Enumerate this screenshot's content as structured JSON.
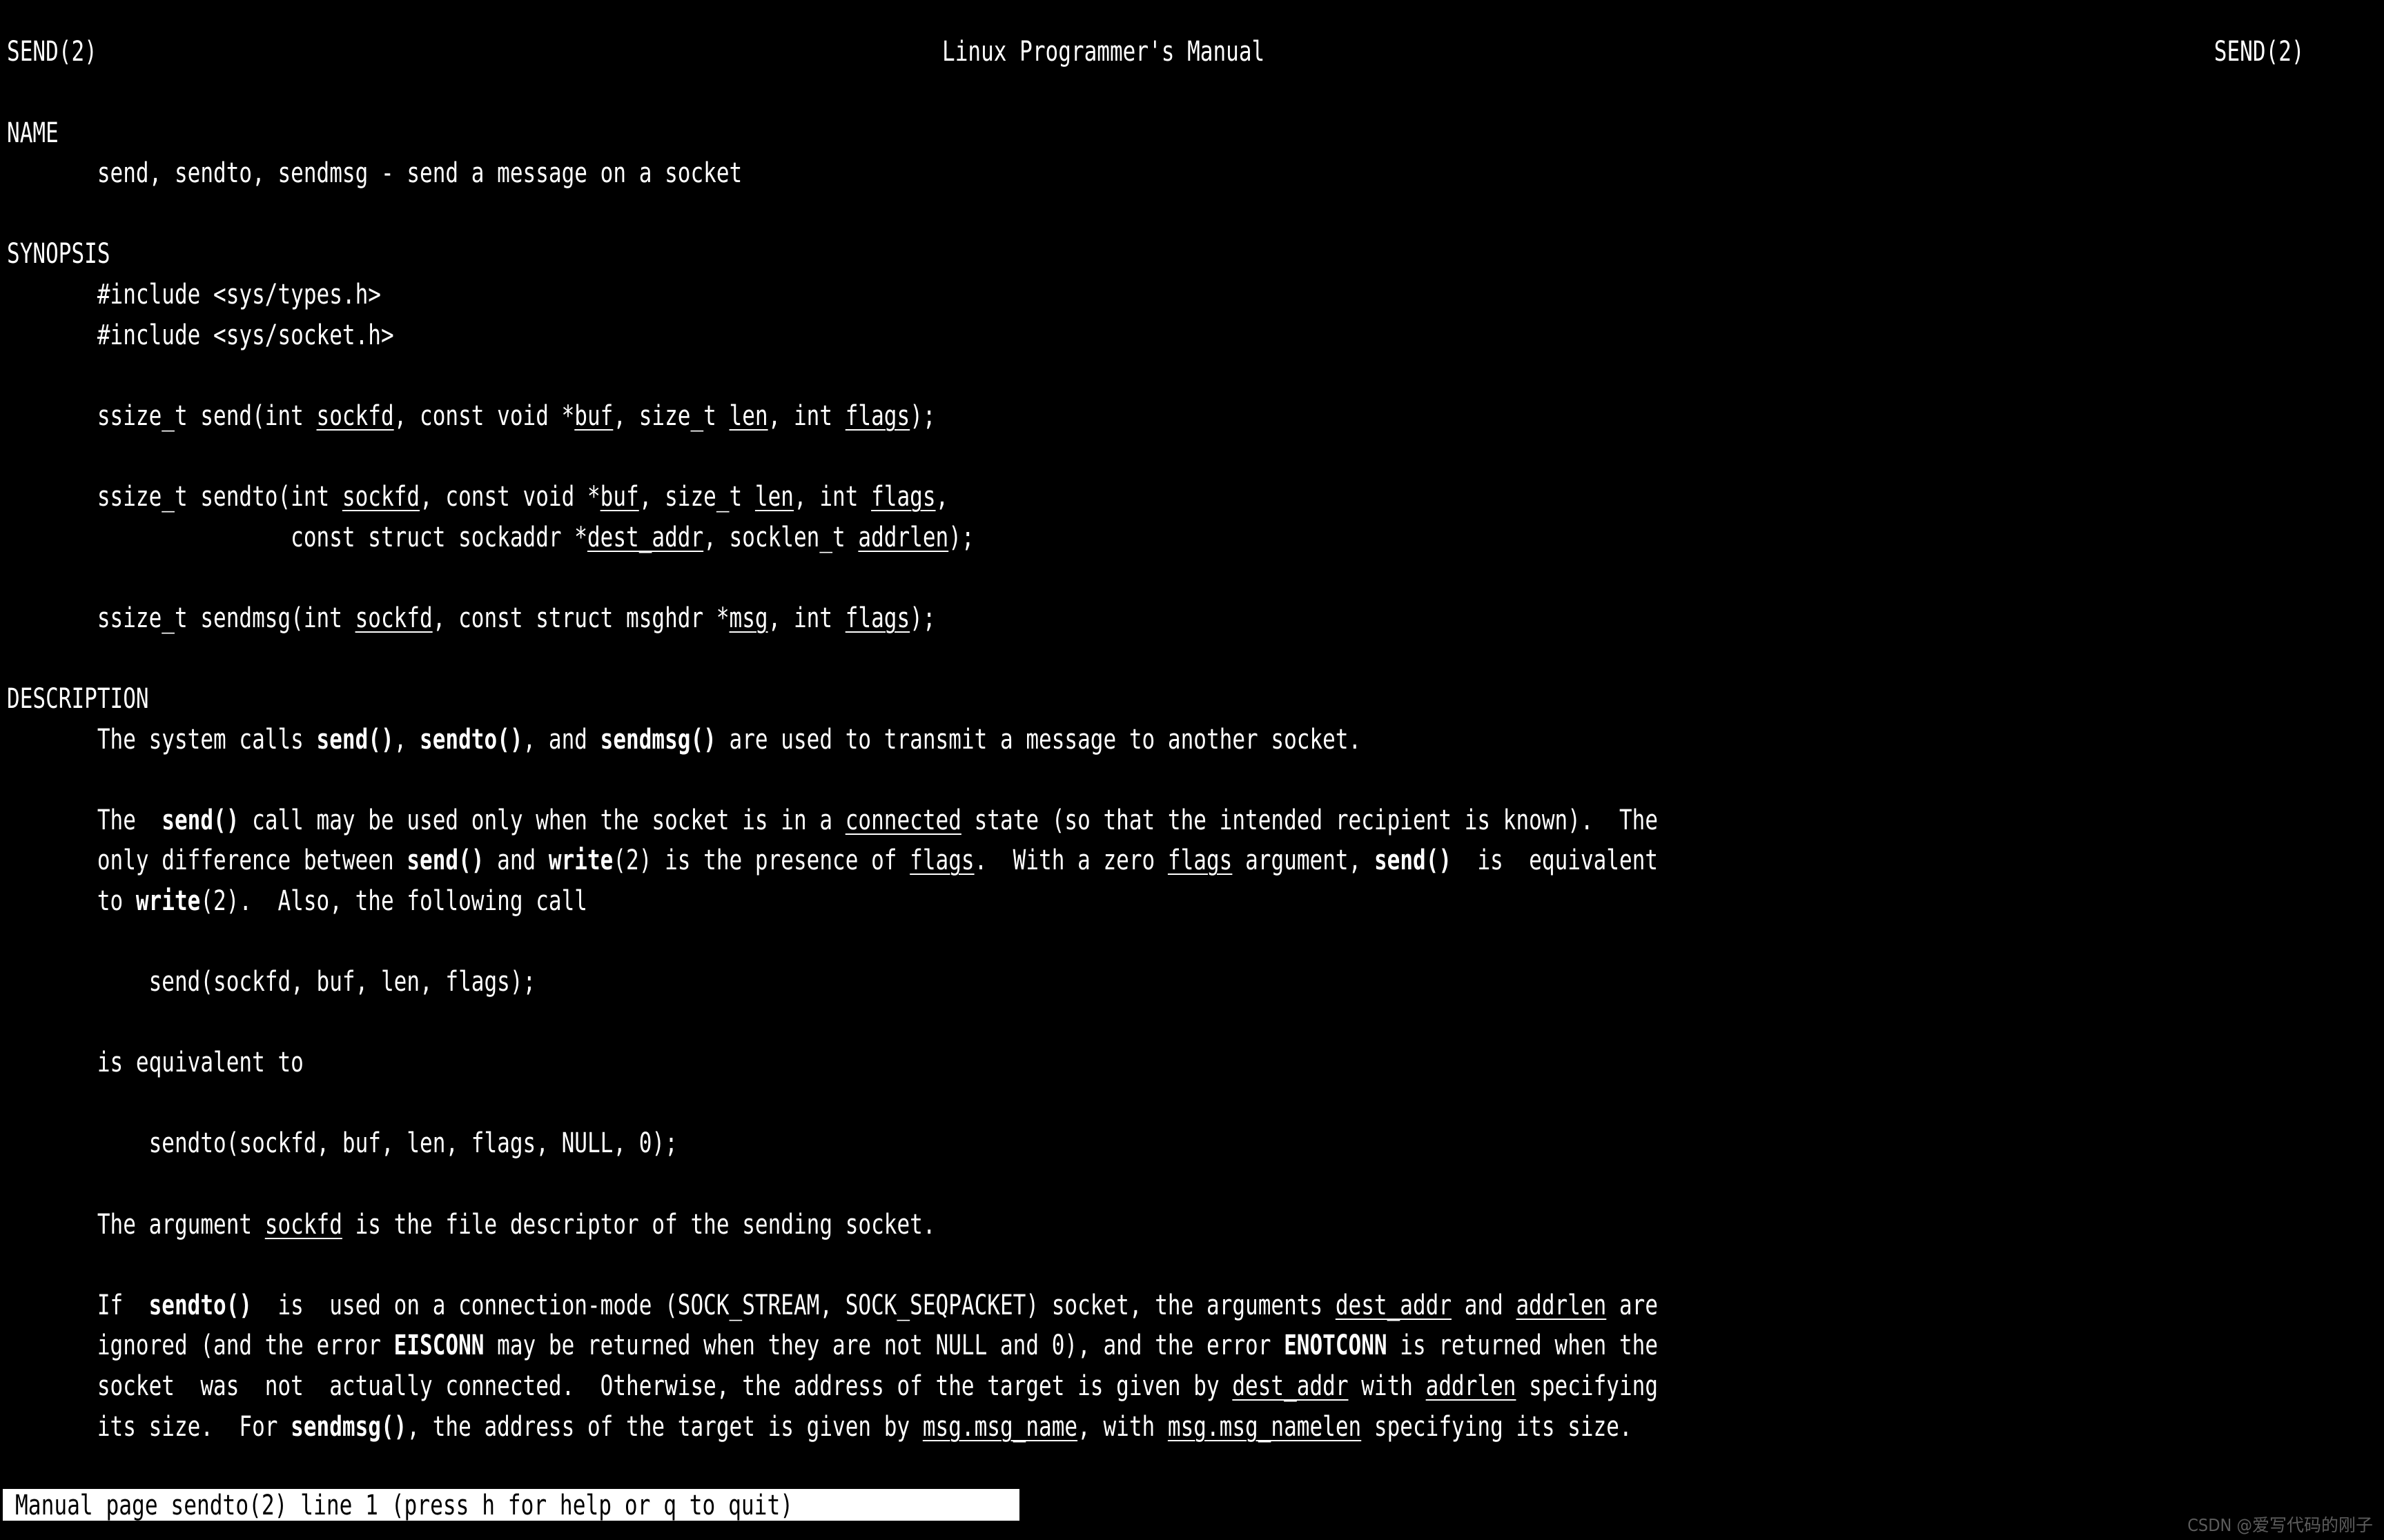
{
  "terminal": {
    "background_color": "#000000",
    "foreground_color": "#ffffff",
    "program": "man"
  },
  "header": {
    "left": "SEND(2)",
    "center": "Linux Programmer's Manual",
    "right": "SEND(2)"
  },
  "sections": {
    "name": {
      "heading": "NAME",
      "body": "send, sendto, sendmsg - send a message on a socket"
    },
    "synopsis": {
      "heading": "SYNOPSIS",
      "include1": "#include <sys/types.h>",
      "include2": "#include <sys/socket.h>",
      "proto_send": {
        "prefix": "ssize_t send(int ",
        "p1": "sockfd",
        "mid1": ", const void *",
        "p2": "buf",
        "mid2": ", size_t ",
        "p3": "len",
        "mid3": ", int ",
        "p4": "flags",
        "suffix": ");"
      },
      "proto_sendto_line1": {
        "prefix": "ssize_t sendto(int ",
        "p1": "sockfd",
        "mid1": ", const void *",
        "p2": "buf",
        "mid2": ", size_t ",
        "p3": "len",
        "mid3": ", int ",
        "p4": "flags",
        "suffix": ","
      },
      "proto_sendto_line2": {
        "prefix": "               const struct sockaddr *",
        "p1": "dest_addr",
        "mid1": ", socklen_t ",
        "p2": "addrlen",
        "suffix": ");"
      },
      "proto_sendmsg": {
        "prefix": "ssize_t sendmsg(int ",
        "p1": "sockfd",
        "mid1": ", const struct msghdr *",
        "p2": "msg",
        "mid2": ", int ",
        "p3": "flags",
        "suffix": ");"
      }
    },
    "description": {
      "heading": "DESCRIPTION",
      "para1": {
        "t1": "The system calls ",
        "b1": "send()",
        "t2": ", ",
        "b2": "sendto()",
        "t3": ", and ",
        "b3": "sendmsg()",
        "t4": " are used to transmit a message to another socket."
      },
      "para2_line1": {
        "t1": "The  ",
        "b1": "send()",
        "t2": " call may be used only when the socket is in a ",
        "u1": "connected",
        "t3": " state (so that the intended recipient is known).  The"
      },
      "para2_line2": {
        "t1": "only difference between ",
        "b1": "send()",
        "t2": " and ",
        "b2": "write",
        "t3": "(2) is the presence of ",
        "u1": "flags",
        "t4": ".  With a zero ",
        "u2": "flags",
        "t5": " argument, ",
        "b3": "send()",
        "t6": "  is  equivalent"
      },
      "para2_line3": {
        "t1": "to ",
        "b1": "write",
        "t2": "(2).  Also, the following call"
      },
      "code1": "    send(sockfd, buf, len, flags);",
      "para3": "is equivalent to",
      "code2": "    sendto(sockfd, buf, len, flags, NULL, 0);",
      "para4": {
        "t1": "The argument ",
        "u1": "sockfd",
        "t2": " is the file descriptor of the sending socket."
      },
      "para5_line1": {
        "t1": "If  ",
        "b1": "sendto()",
        "t2": "  is  used on a connection-mode (SOCK_STREAM, SOCK_SEQPACKET) socket, the arguments ",
        "u1": "dest_addr",
        "t3": " and ",
        "u2": "addrlen",
        "t4": " are"
      },
      "para5_line2": {
        "t1": "ignored (and the error ",
        "b1": "EISCONN",
        "t2": " may be returned when they are not NULL and 0), and the error ",
        "b2": "ENOTCONN",
        "t3": " is returned when the"
      },
      "para5_line3": {
        "t1": "socket  was  not  actually connected.  Otherwise, the address of the target is given by ",
        "u1": "dest_addr",
        "t2": " with ",
        "u2": "addrlen",
        "t3": " specifying"
      },
      "para5_line4": {
        "t1": "its size.  For ",
        "b1": "sendmsg()",
        "t2": ", the address of the target is given by ",
        "u1": "msg.msg_name",
        "t3": ", with ",
        "u2": "msg.msg_namelen",
        "t4": " specifying its size."
      }
    }
  },
  "statusbar": {
    "text": "Manual page sendto(2) line 1 (press h for help or q to quit)",
    "background_color": "#ffffff",
    "foreground_color": "#000000"
  },
  "watermark": {
    "text": "CSDN @爱写代码的刚子"
  }
}
